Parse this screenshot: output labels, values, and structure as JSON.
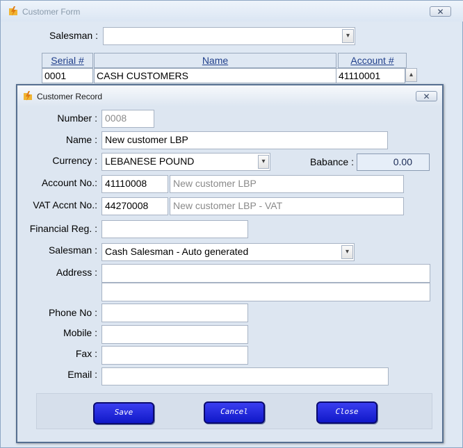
{
  "back_window": {
    "title": "Customer Form",
    "salesman_label": "Salesman :",
    "salesman_value": "",
    "grid": {
      "columns": [
        "Serial #",
        "Name",
        "Account #"
      ],
      "rows": [
        [
          "0001",
          "CASH CUSTOMERS",
          "41110001"
        ]
      ]
    }
  },
  "dialog": {
    "title": "Customer Record",
    "close_glyph": "✕",
    "fields": {
      "number": {
        "label": "Number :",
        "value": "0008"
      },
      "name": {
        "label": "Name :",
        "value": "New customer LBP"
      },
      "currency": {
        "label": "Currency :",
        "value": "LEBANESE POUND"
      },
      "balance": {
        "label": "Babance :",
        "value": "0.00"
      },
      "account": {
        "label": "Account No.:",
        "value": "41110008",
        "desc": "New customer LBP"
      },
      "vat": {
        "label": "VAT Accnt No.:",
        "value": "44270008",
        "desc": "New customer LBP - VAT"
      },
      "financial": {
        "label": "Financial Reg. :",
        "value": ""
      },
      "salesman": {
        "label": "Salesman :",
        "value": "Cash Salesman - Auto generated"
      },
      "address": {
        "label": "Address :",
        "line1": "",
        "line2": ""
      },
      "phone": {
        "label": "Phone No :",
        "value": ""
      },
      "mobile": {
        "label": "Mobile :",
        "value": ""
      },
      "fax": {
        "label": "Fax :",
        "value": ""
      },
      "email": {
        "label": "Email :",
        "value": ""
      }
    },
    "buttons": {
      "save": "Save",
      "cancel": "Cancel",
      "close": "Close"
    }
  },
  "icons": {
    "app": "lightning-folder-icon",
    "dropdown": "chevron-down-icon",
    "scroll": "scroll-up-icon",
    "close": "close-icon"
  },
  "colors": {
    "button_blue": "#1a22d8",
    "title_bg": "#dfe8f3",
    "header_link": "#1f3e8a",
    "readonly_text": "#8a8a8a"
  }
}
